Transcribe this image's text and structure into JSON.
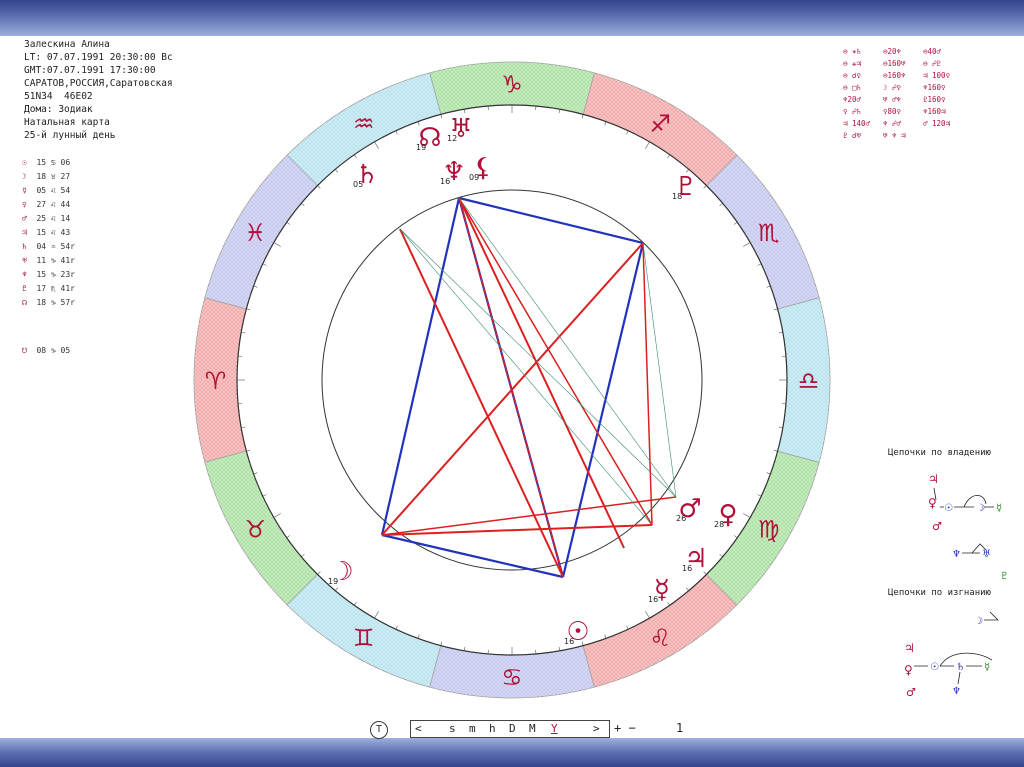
{
  "header_info": {
    "name": "Залескина Алина",
    "local_time": "LT: 07.07.1991 20:30:00 Вс",
    "gmt_time": "GMT:07.07.1991 17:30:00",
    "place": "САРАТОВ,РОССИЯ,Саратовская",
    "coords": "51N34  46E02",
    "houses": "Дома: Зодиак",
    "chart_type": "Натальная карта",
    "lunar_day": "25-й лунный день"
  },
  "planet_positions": [
    {
      "glyph": "☉",
      "position": "15 ♋ 06"
    },
    {
      "glyph": "☽",
      "position": "18 ♉ 27"
    },
    {
      "glyph": "☿",
      "position": "05 ♌ 54"
    },
    {
      "glyph": "♀",
      "position": "27 ♌ 44"
    },
    {
      "glyph": "♂",
      "position": "25 ♌ 14"
    },
    {
      "glyph": "♃",
      "position": "15 ♌ 43"
    },
    {
      "glyph": "♄",
      "position": "04 ♒ 54r"
    },
    {
      "glyph": "♅",
      "position": "11 ♑ 41r"
    },
    {
      "glyph": "♆",
      "position": "15 ♑ 23r"
    },
    {
      "glyph": "♇",
      "position": "17 ♏ 41r"
    },
    {
      "glyph": "☊",
      "position": "18 ♑ 57r"
    }
  ],
  "extra_point": {
    "glyph": "☋",
    "position": "08 ♑ 05"
  },
  "aspect_table": [
    "⊖ ✶♄",
    "⊖20♆",
    "⊖40♂",
    "⊖ ⚹♃",
    "⊖160♅",
    "⊖ ☍♇",
    "⊖ ☌♀",
    "⊖160♆",
    "♃ 100♀",
    "⊖ □♄",
    "☽ ☍♀",
    "♆160♀",
    "♆20♂",
    "♅ ♂♆",
    "♇160♀",
    "♀ ☍♄",
    "♀80♀",
    "♆160♃",
    "♃ 140♂",
    "♆ ☍♂",
    "♂ 120♃",
    "♇ ☌♅",
    "♅ ♆ ♃",
    ""
  ],
  "zodiac_signs": [
    {
      "glyph": "♈",
      "element": "fire"
    },
    {
      "glyph": "♉",
      "element": "earth"
    },
    {
      "glyph": "♊",
      "element": "air"
    },
    {
      "glyph": "♋",
      "element": "water"
    },
    {
      "glyph": "♌",
      "element": "fire"
    },
    {
      "glyph": "♍",
      "element": "earth"
    },
    {
      "glyph": "♎",
      "element": "air"
    },
    {
      "glyph": "♏",
      "element": "water"
    },
    {
      "glyph": "♐",
      "element": "fire"
    },
    {
      "glyph": "♑",
      "element": "earth"
    },
    {
      "glyph": "♒",
      "element": "air"
    },
    {
      "glyph": "♓",
      "element": "water"
    }
  ],
  "element_colors": {
    "fire": "#f2a6a6",
    "earth": "#a9e0a0",
    "air": "#b6e3ee",
    "water": "#c2c6ee"
  },
  "chart_planets": [
    {
      "glyph": "☉",
      "degree": "16",
      "name": "sun"
    },
    {
      "glyph": "☽",
      "degree": "19",
      "name": "moon"
    },
    {
      "glyph": "☿",
      "degree": "16",
      "name": "mercury"
    },
    {
      "glyph": "♀",
      "degree": "28",
      "name": "venus"
    },
    {
      "glyph": "♂",
      "degree": "26",
      "name": "mars"
    },
    {
      "glyph": "♃",
      "degree": "16",
      "name": "jupiter"
    },
    {
      "glyph": "♄",
      "degree": "05",
      "name": "saturn"
    },
    {
      "glyph": "♅",
      "degree": "12",
      "name": "uranus"
    },
    {
      "glyph": "♆",
      "degree": "16",
      "name": "neptune"
    },
    {
      "glyph": "♇",
      "degree": "18",
      "name": "pluto"
    },
    {
      "glyph": "☊",
      "degree": "19",
      "name": "node"
    },
    {
      "glyph": "⚸",
      "degree": "09",
      "name": "lilith"
    }
  ],
  "chains": {
    "ownership_title": "Цепочки по владению",
    "exile_title": "Цепочки по изгнанию"
  },
  "toolbar": {
    "t_label": "T",
    "left_arrow": "<",
    "s": "s",
    "m": "m",
    "h": "h",
    "D": "D",
    "M": "M",
    "Y": "Y",
    "right_arrow": ">",
    "plus_minus": "+ −",
    "step": "1"
  },
  "colors": {
    "square_line": "#2233bb",
    "opposition_line": "#dd1f1f",
    "minor_line": "#3a8a7a",
    "glyph_color": "#b0103a"
  }
}
